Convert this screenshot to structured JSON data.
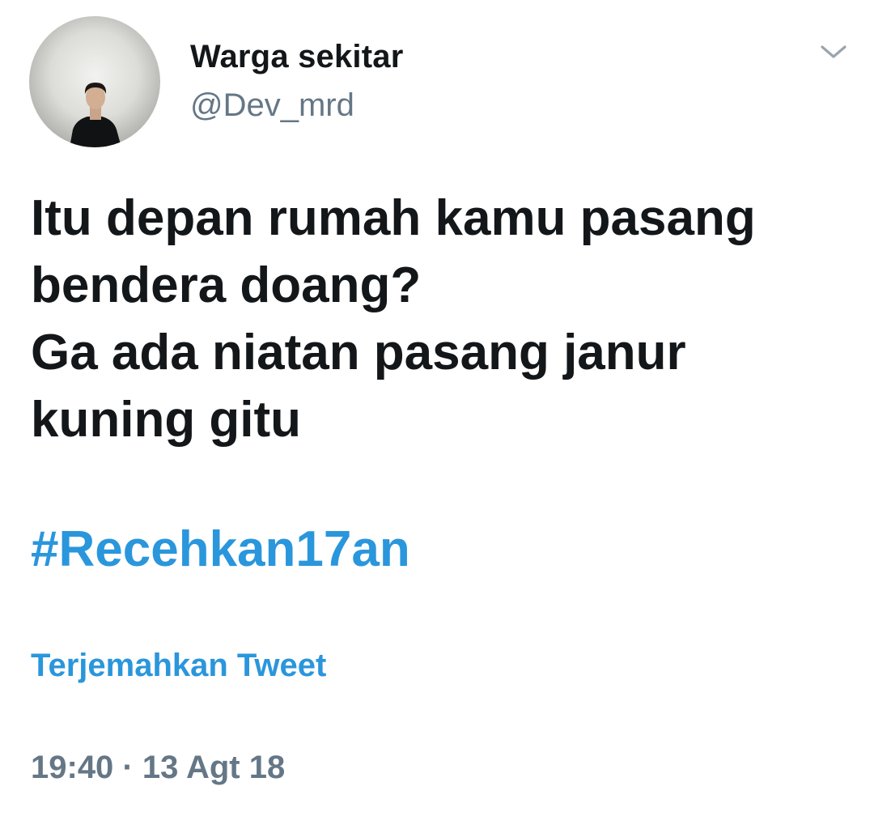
{
  "tweet": {
    "author": {
      "display_name": "Warga sekitar",
      "handle": "@Dev_mrd",
      "avatar_icon": "profile-photo"
    },
    "menu_icon": "chevron-down-icon",
    "text_lines": [
      "Itu depan rumah kamu pasang",
      "bendera doang?",
      "Ga ada niatan pasang janur",
      "kuning gitu"
    ],
    "hashtag": "#Recehkan17an",
    "translate_label": "Terjemahkan Tweet",
    "timestamp": "19:40 · 13 Agt 18",
    "colors": {
      "text": "#14171a",
      "secondary": "#657786",
      "link": "#2a96dc",
      "background": "#ffffff"
    }
  }
}
